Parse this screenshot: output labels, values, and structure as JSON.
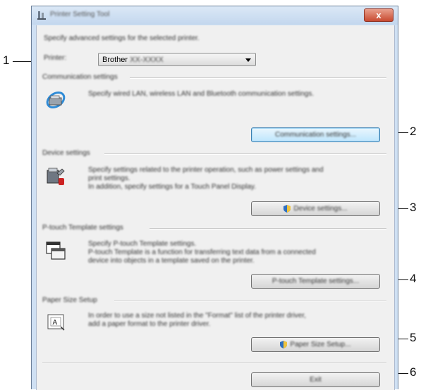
{
  "callouts": [
    "1",
    "2",
    "3",
    "4",
    "5",
    "6"
  ],
  "window": {
    "title": "Printer Setting Tool",
    "close_label": "x"
  },
  "header": {
    "description": "Specify advanced settings for the selected printer.",
    "printer_label": "Printer:",
    "printer_value_brand": "Brother",
    "printer_value_model": "XX-XXXX"
  },
  "groups": [
    {
      "title": "Communication settings",
      "description": [
        "Specify wired LAN, wireless LAN and Bluetooth communication settings."
      ],
      "button_label": "Communication settings..."
    },
    {
      "title": "Device settings",
      "description": [
        "Specify settings related to the printer operation, such as power settings and",
        "print settings.",
        "In addition, specify settings for a Touch Panel Display."
      ],
      "button_label": "Device settings..."
    },
    {
      "title": "P-touch Template settings",
      "description": [
        "Specify P-touch Template settings.",
        "P-touch Template is a function for transferring text data from a connected",
        "device into objects in a template saved on the printer."
      ],
      "button_label": "P-touch Template settings..."
    },
    {
      "title": "Paper Size Setup",
      "description": [
        "In order to use a size not listed in the \"Format\" list of the printer driver,",
        "add a paper format to the printer driver."
      ],
      "button_label": "Paper Size Setup..."
    }
  ],
  "exit_label": "Exit",
  "colors": {
    "close_red": "#c84a31",
    "focus_blue": "#3c7fb1",
    "title_bar": "#cfe0f3"
  }
}
